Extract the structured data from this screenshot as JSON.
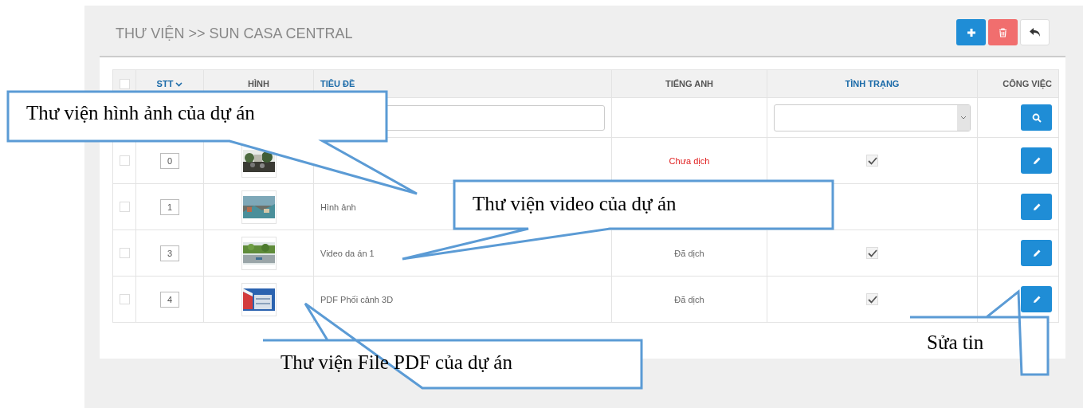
{
  "header": {
    "title": "THƯ VIỆN >> SUN CASA CENTRAL"
  },
  "toolbar": {
    "buttons": [
      {
        "kind": "add"
      },
      {
        "kind": "delete"
      },
      {
        "kind": "back"
      }
    ]
  },
  "table": {
    "select_all": {
      "checked": false
    },
    "columns": [
      {
        "label": "STT",
        "sortable": true,
        "sorted": true
      },
      {
        "label": "HÌNH",
        "sortable": false,
        "sorted": false
      },
      {
        "label": "TIÊU ĐỀ",
        "sortable": true,
        "sorted": false
      },
      {
        "label": "TIẾNG ANH",
        "sortable": false,
        "sorted": false
      },
      {
        "label": "TÌNH TRẠNG",
        "sortable": true,
        "sorted": false
      },
      {
        "label": "CÔNG VIỆC",
        "sortable": false,
        "sorted": false
      }
    ],
    "filters": {
      "title_field": {
        "kind": "text"
      },
      "status_select": {
        "kind": "select"
      },
      "search_button": {
        "kind": "search"
      }
    },
    "rows": [
      {
        "selected": false,
        "order": "0",
        "translation": "Chưa dịch",
        "translated": false,
        "status_checked": true
      },
      {
        "selected": false,
        "order": "1",
        "title": "Hình ảnh"
      },
      {
        "selected": false,
        "order": "3",
        "title": "Video da án 1",
        "translation": "Đã dịch",
        "translated": true,
        "status_checked": true
      },
      {
        "selected": false,
        "order": "4",
        "title": "PDF Phối cảnh 3D",
        "translation": "Đã dịch",
        "translated": true,
        "status_checked": true
      }
    ]
  },
  "callouts": [
    {
      "text": "Thư viện hình ảnh của dự án"
    },
    {
      "text": "Thư viện video của dự án"
    },
    {
      "text": "Thư viện File PDF của dự án"
    },
    {
      "text": "Sửa tin"
    }
  ]
}
